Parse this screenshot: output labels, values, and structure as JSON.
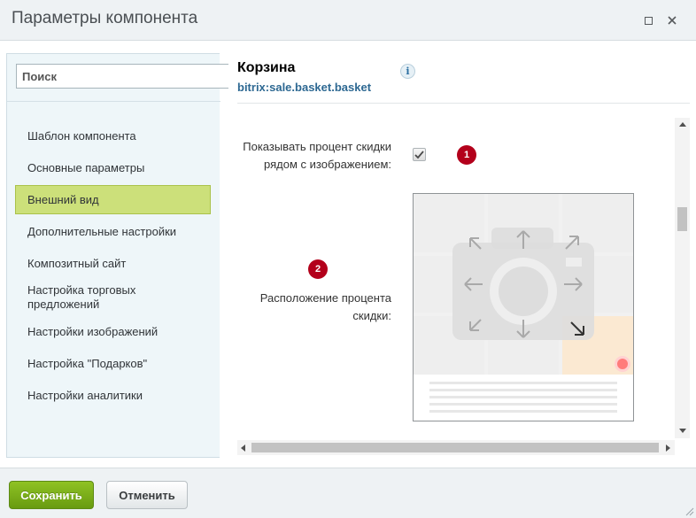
{
  "window": {
    "title": "Параметры компонента",
    "maximize_icon": "maximize-icon",
    "close_icon": "close-icon"
  },
  "search": {
    "placeholder": "Поиск",
    "value": ""
  },
  "sidebar": {
    "items": [
      {
        "label": "Шаблон компонента",
        "active": false
      },
      {
        "label": "Основные параметры",
        "active": false
      },
      {
        "label": "Внешний вид",
        "active": true
      },
      {
        "label": "Дополнительные настройки",
        "active": false
      },
      {
        "label": "Композитный сайт",
        "active": false
      },
      {
        "label": "Настройка торговых предложений",
        "active": false
      },
      {
        "label": "Настройки изображений",
        "active": false
      },
      {
        "label": "Настройка \"Подарков\"",
        "active": false
      },
      {
        "label": "Настройки аналитики",
        "active": false
      }
    ]
  },
  "component": {
    "title": "Корзина",
    "code": "bitrix:sale.basket.basket",
    "info_icon": "i"
  },
  "fields": {
    "show_discount": {
      "label_line1": "Показывать процент скидки",
      "label_line2": "рядом с изображением:",
      "checked": true,
      "badge": "1"
    },
    "discount_position": {
      "label_line1": "Расположение процента",
      "label_line2": "скидки:",
      "badge": "2",
      "selected_position": "bottom-right"
    }
  },
  "colors": {
    "accent_active": "#cce07a",
    "badge": "#b3001b",
    "save_button": "#7aad18",
    "link": "#2d6892",
    "selected_cell": "#fbe9d2"
  },
  "footer": {
    "save_label": "Сохранить",
    "cancel_label": "Отменить"
  }
}
